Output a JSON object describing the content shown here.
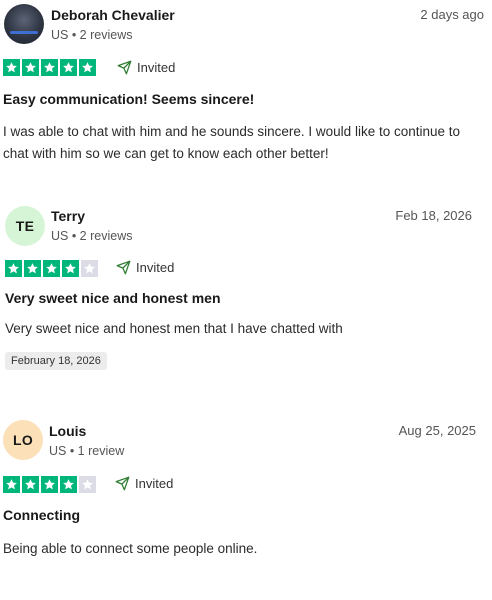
{
  "reviews": [
    {
      "name": "Deborah Chevalier",
      "meta": "US • 2 reviews",
      "date": "2 days ago",
      "rating": 5,
      "verified": "Invited",
      "title": "Easy communication! Seems sincere!",
      "body": "I was able to chat with him and he sounds sincere. I would like to continue to chat with him so we can get to know each other better!"
    },
    {
      "name": "Terry",
      "initials": "TE",
      "avatar_color": "#d6f5d6",
      "meta": "US • 2 reviews",
      "date": "Feb 18, 2026",
      "rating": 4,
      "verified": "Invited",
      "title": "Very sweet nice and honest men",
      "body": "Very sweet nice and honest men that I have chatted with",
      "experience_date": "February 18, 2026"
    },
    {
      "name": "Louis",
      "initials": "LO",
      "avatar_color": "#fbe0b8",
      "meta": "US • 1 review",
      "date": "Aug 25, 2025",
      "rating": 4,
      "verified": "Invited",
      "title": "Connecting",
      "body": "Being able to connect some people online."
    }
  ],
  "colors": {
    "star_on": "#00b67a",
    "star_off": "#dcdce6"
  },
  "icons": {
    "star": "star-icon",
    "invited": "paper-plane-icon"
  }
}
